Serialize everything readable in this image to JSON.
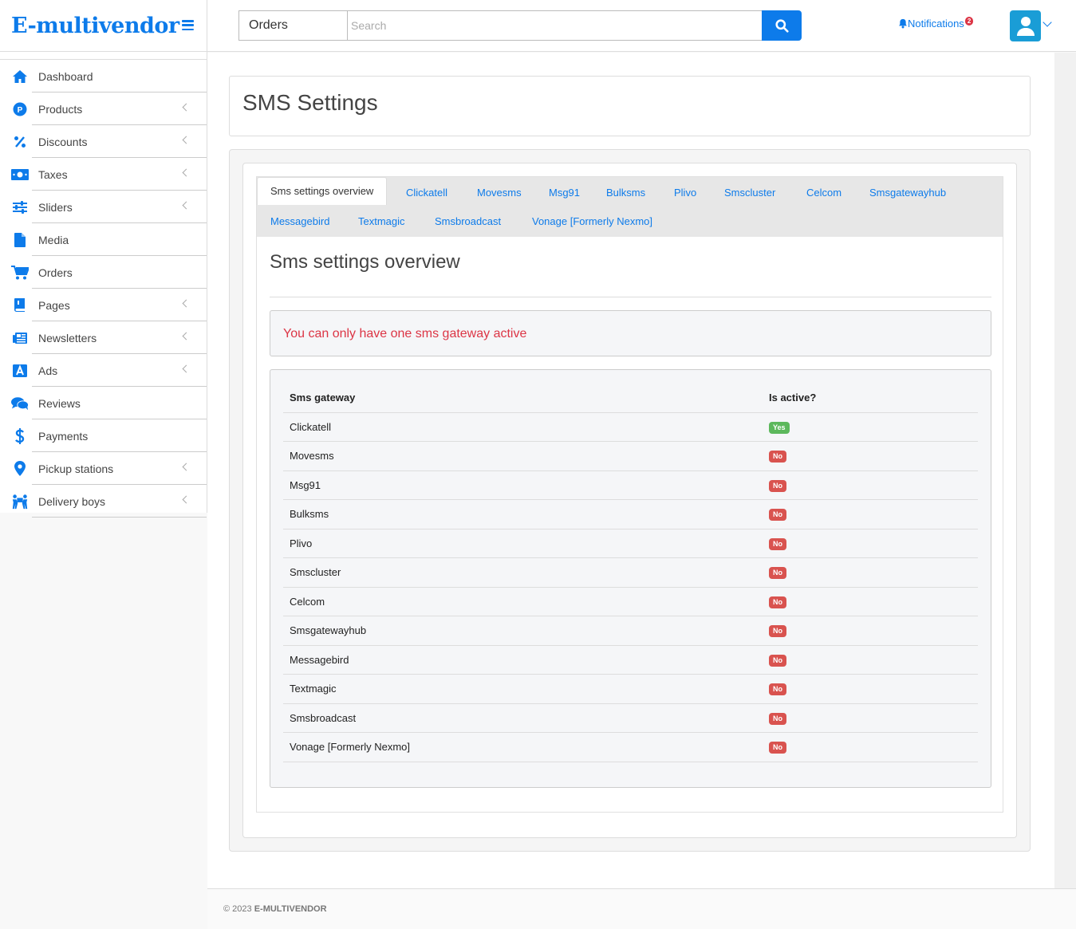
{
  "brand": {
    "name": "E-multivendor"
  },
  "sidebar": {
    "items": [
      {
        "label": "Dashboard",
        "icon": "home-icon",
        "has_submenu": false
      },
      {
        "label": "Products",
        "icon": "products-p-icon",
        "has_submenu": true
      },
      {
        "label": "Discounts",
        "icon": "percent-icon",
        "has_submenu": true
      },
      {
        "label": "Taxes",
        "icon": "money-bill-icon",
        "has_submenu": true
      },
      {
        "label": "Sliders",
        "icon": "sliders-icon",
        "has_submenu": true
      },
      {
        "label": "Media",
        "icon": "file-icon",
        "has_submenu": false
      },
      {
        "label": "Orders",
        "icon": "cart-icon",
        "has_submenu": false
      },
      {
        "label": "Pages",
        "icon": "book-icon",
        "has_submenu": true
      },
      {
        "label": "Newsletters",
        "icon": "newspaper-icon",
        "has_submenu": true
      },
      {
        "label": "Ads",
        "icon": "ad-icon",
        "has_submenu": true
      },
      {
        "label": "Reviews",
        "icon": "comments-icon",
        "has_submenu": false
      },
      {
        "label": "Payments",
        "icon": "dollar-icon",
        "has_submenu": false
      },
      {
        "label": "Pickup stations",
        "icon": "map-marker-icon",
        "has_submenu": true
      },
      {
        "label": "Delivery boys",
        "icon": "people-carry-icon",
        "has_submenu": true
      }
    ]
  },
  "header": {
    "search_category": "Orders",
    "search_placeholder": "Search",
    "notifications_label": "Notifications",
    "notifications_count": "2"
  },
  "page": {
    "title": "SMS Settings",
    "tabs": [
      {
        "label": "Sms settings overview",
        "active": true
      },
      {
        "label": "Clickatell"
      },
      {
        "label": "Movesms"
      },
      {
        "label": "Msg91"
      },
      {
        "label": "Bulksms"
      },
      {
        "label": "Plivo"
      },
      {
        "label": "Smscluster"
      },
      {
        "label": "Celcom"
      },
      {
        "label": "Smsgatewayhub"
      },
      {
        "label": "Messagebird"
      },
      {
        "label": "Textmagic"
      },
      {
        "label": "Smsbroadcast"
      },
      {
        "label": "Vonage [Formerly Nexmo]"
      }
    ],
    "panel_title": "Sms settings overview",
    "alert": "You can only have one sms gateway active",
    "table": {
      "headers": [
        "Sms gateway",
        "Is active?"
      ],
      "rows": [
        {
          "gateway": "Clickatell",
          "active": "Yes"
        },
        {
          "gateway": "Movesms",
          "active": "No"
        },
        {
          "gateway": "Msg91",
          "active": "No"
        },
        {
          "gateway": "Bulksms",
          "active": "No"
        },
        {
          "gateway": "Plivo",
          "active": "No"
        },
        {
          "gateway": "Smscluster",
          "active": "No"
        },
        {
          "gateway": "Celcom",
          "active": "No"
        },
        {
          "gateway": "Smsgatewayhub",
          "active": "No"
        },
        {
          "gateway": "Messagebird",
          "active": "No"
        },
        {
          "gateway": "Textmagic",
          "active": "No"
        },
        {
          "gateway": "Smsbroadcast",
          "active": "No"
        },
        {
          "gateway": "Vonage [Formerly Nexmo]",
          "active": "No"
        }
      ]
    }
  },
  "footer": {
    "copyright": "© 2023",
    "brand": "E-MULTIVENDOR"
  },
  "colors": {
    "accent": "#0d7bea",
    "danger": "#dc3545",
    "success": "#5cb85c"
  }
}
